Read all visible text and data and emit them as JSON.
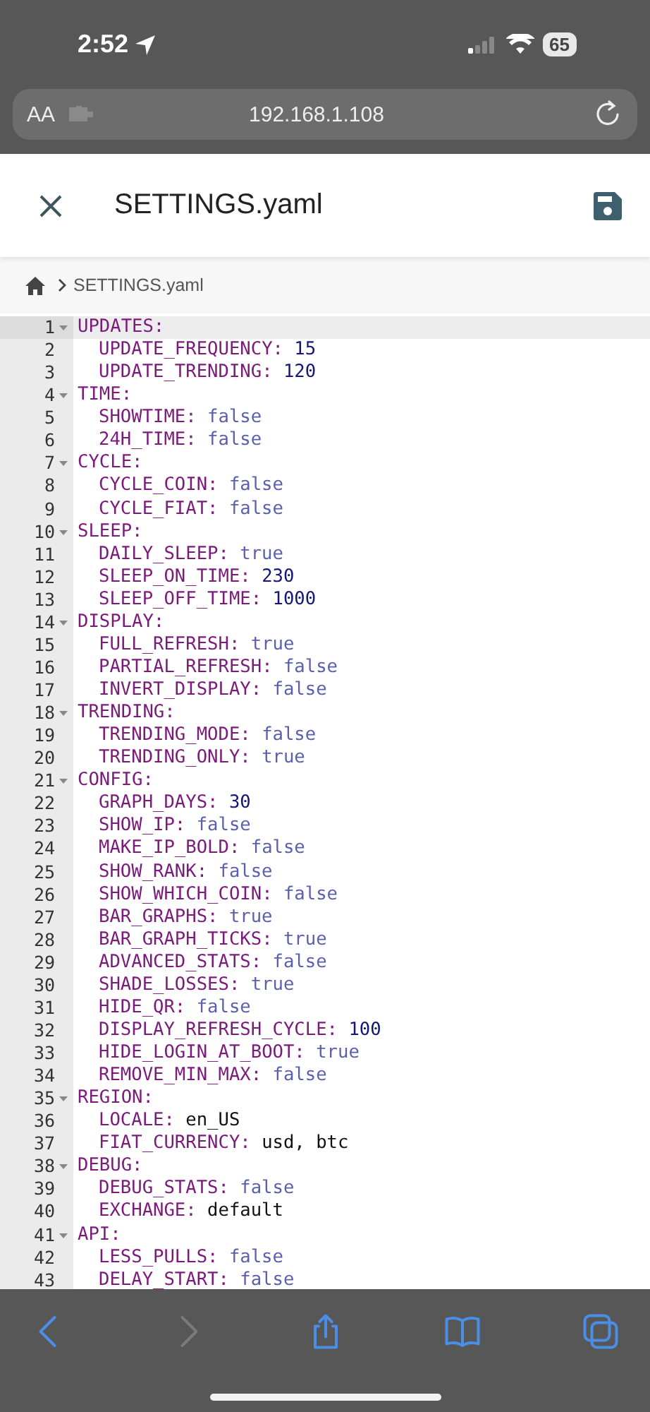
{
  "status_bar": {
    "time": "2:52",
    "battery": "65"
  },
  "address_bar": {
    "text_size": "AA",
    "url": "192.168.1.108"
  },
  "header": {
    "title": "SETTINGS.yaml"
  },
  "breadcrumb": {
    "current": "SETTINGS.yaml"
  },
  "editor": {
    "sections": [
      {
        "n": "1",
        "key": "UPDATES:",
        "expanded": true,
        "active": true,
        "children": [
          {
            "n": "2",
            "key": "UPDATE_FREQUENCY:",
            "value": "15",
            "kind": "number"
          },
          {
            "n": "3",
            "key": "UPDATE_TRENDING:",
            "value": "120",
            "kind": "number"
          }
        ]
      },
      {
        "n": "4",
        "key": "TIME:",
        "expanded": true,
        "active": false,
        "children": [
          {
            "n": "5",
            "key": "SHOWTIME:",
            "value": "false",
            "kind": "bool"
          },
          {
            "n": "6",
            "key": "24H_TIME:",
            "value": "false",
            "kind": "bool"
          }
        ]
      },
      {
        "n": "7",
        "key": "CYCLE:",
        "expanded": true,
        "active": false,
        "children": [
          {
            "n": "8",
            "key": "CYCLE_COIN:",
            "value": "false",
            "kind": "bool"
          },
          {
            "n": "9",
            "key": "CYCLE_FIAT:",
            "value": "false",
            "kind": "bool"
          }
        ]
      },
      {
        "n": "10",
        "key": "SLEEP:",
        "expanded": true,
        "active": false,
        "children": [
          {
            "n": "11",
            "key": "DAILY_SLEEP:",
            "value": "true",
            "kind": "bool"
          },
          {
            "n": "12",
            "key": "SLEEP_ON_TIME:",
            "value": "230",
            "kind": "number"
          },
          {
            "n": "13",
            "key": "SLEEP_OFF_TIME:",
            "value": "1000",
            "kind": "number"
          }
        ]
      },
      {
        "n": "14",
        "key": "DISPLAY:",
        "expanded": true,
        "active": false,
        "children": [
          {
            "n": "15",
            "key": "FULL_REFRESH:",
            "value": "true",
            "kind": "bool"
          },
          {
            "n": "16",
            "key": "PARTIAL_REFRESH:",
            "value": "false",
            "kind": "bool"
          },
          {
            "n": "17",
            "key": "INVERT_DISPLAY:",
            "value": "false",
            "kind": "bool"
          }
        ]
      },
      {
        "n": "18",
        "key": "TRENDING:",
        "expanded": true,
        "active": false,
        "children": [
          {
            "n": "19",
            "key": "TRENDING_MODE:",
            "value": "false",
            "kind": "bool"
          },
          {
            "n": "20",
            "key": "TRENDING_ONLY:",
            "value": "true",
            "kind": "bool"
          }
        ]
      },
      {
        "n": "21",
        "key": "CONFIG:",
        "expanded": true,
        "active": false,
        "children": [
          {
            "n": "22",
            "key": "GRAPH_DAYS:",
            "value": "30",
            "kind": "number"
          },
          {
            "n": "23",
            "key": "SHOW_IP:",
            "value": "false",
            "kind": "bool"
          },
          {
            "n": "24",
            "key": "MAKE_IP_BOLD:",
            "value": "false",
            "kind": "bool"
          },
          {
            "n": "25",
            "key": "SHOW_RANK:",
            "value": "false",
            "kind": "bool"
          },
          {
            "n": "26",
            "key": "SHOW_WHICH_COIN:",
            "value": "false",
            "kind": "bool"
          },
          {
            "n": "27",
            "key": "BAR_GRAPHS:",
            "value": "true",
            "kind": "bool"
          },
          {
            "n": "28",
            "key": "BAR_GRAPH_TICKS:",
            "value": "true",
            "kind": "bool"
          },
          {
            "n": "29",
            "key": "ADVANCED_STATS:",
            "value": "false",
            "kind": "bool"
          },
          {
            "n": "30",
            "key": "SHADE_LOSSES:",
            "value": "true",
            "kind": "bool"
          },
          {
            "n": "31",
            "key": "HIDE_QR:",
            "value": "false",
            "kind": "bool"
          },
          {
            "n": "32",
            "key": "DISPLAY_REFRESH_CYCLE:",
            "value": "100",
            "kind": "number"
          },
          {
            "n": "33",
            "key": "HIDE_LOGIN_AT_BOOT:",
            "value": "true",
            "kind": "bool"
          },
          {
            "n": "34",
            "key": "REMOVE_MIN_MAX:",
            "value": "false",
            "kind": "bool"
          }
        ]
      },
      {
        "n": "35",
        "key": "REGION:",
        "expanded": true,
        "active": false,
        "children": [
          {
            "n": "36",
            "key": "LOCALE:",
            "value": "en_US",
            "kind": "string"
          },
          {
            "n": "37",
            "key": "FIAT_CURRENCY:",
            "value": "usd, btc",
            "kind": "string"
          }
        ]
      },
      {
        "n": "38",
        "key": "DEBUG:",
        "expanded": true,
        "active": false,
        "children": [
          {
            "n": "39",
            "key": "DEBUG_STATS:",
            "value": "false",
            "kind": "bool"
          },
          {
            "n": "40",
            "key": "EXCHANGE:",
            "value": "default",
            "kind": "string"
          }
        ]
      },
      {
        "n": "41",
        "key": "API:",
        "expanded": true,
        "active": false,
        "children": [
          {
            "n": "42",
            "key": "LESS_PULLS:",
            "value": "false",
            "kind": "bool"
          },
          {
            "n": "43",
            "key": "DELAY_START:",
            "value": "false",
            "kind": "bool"
          }
        ]
      }
    ]
  },
  "toolbar": [
    {
      "kind": "back",
      "disabled": false
    },
    {
      "kind": "forward",
      "disabled": true
    },
    {
      "kind": "share",
      "disabled": false
    },
    {
      "kind": "bookmarks",
      "disabled": false
    },
    {
      "kind": "tabs",
      "disabled": false
    }
  ]
}
